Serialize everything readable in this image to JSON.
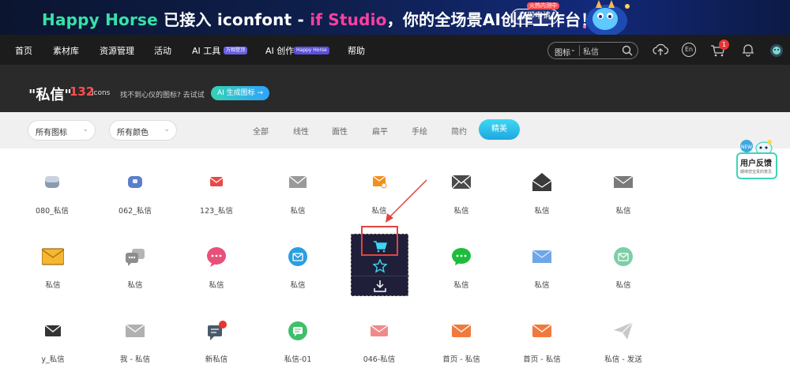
{
  "banner": {
    "brand": "Happy Horse",
    "text_a": " 已接入 iconfont - ",
    "text_if": "if Studio",
    "text_b": "，你的全场景AI创作工作台！",
    "button": "立即申请",
    "button_badge": "火热内测中"
  },
  "nav": {
    "items": [
      "首页",
      "素材库",
      "资源管理",
      "活动",
      "AI 工具",
      "AI 创作",
      "帮助"
    ],
    "ai_tools_tag": "万相登顶",
    "ai_create_tag": "Happy Horse",
    "search_scope": "图标",
    "search_value": "私信",
    "cart_count": "1",
    "lang_label": "En"
  },
  "hero": {
    "title": "\"私信\"",
    "count": "132",
    "unit": "icons",
    "hint": "找不到心仪的图标? 去试试",
    "ai_button": "AI 生成图标 →"
  },
  "filters": {
    "dropdown_icons": "所有图标",
    "dropdown_colors": "所有颜色",
    "styles": [
      "全部",
      "线性",
      "面性",
      "扁平",
      "手绘",
      "简约"
    ],
    "active_style": "精美"
  },
  "icons": {
    "row1": [
      "080_私信",
      "062_私信",
      "123_私信",
      "私信",
      "私信",
      "私信",
      "私信",
      "私信"
    ],
    "row2": [
      "私信",
      "私信",
      "私信",
      "私信",
      "",
      "私信",
      "私信",
      "私信"
    ],
    "row3": [
      "y_私信",
      "我 - 私信",
      "新私信",
      "私信-01",
      "046-私信",
      "首页 - 私信",
      "首页 - 私信",
      "私信 - 发送"
    ]
  },
  "feedback": {
    "title": "用户反馈",
    "subtitle": "期待您宝贵的意见",
    "badge": "NEW"
  },
  "colors": {
    "accent": "#1ea8e0",
    "hero_count": "#ff4d4f",
    "annotation": "#e0443e"
  }
}
